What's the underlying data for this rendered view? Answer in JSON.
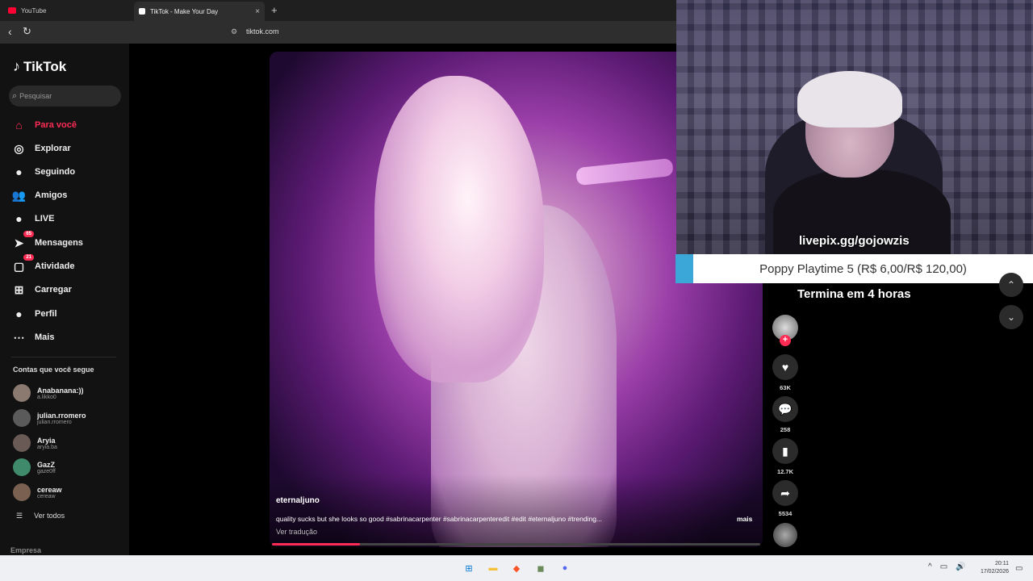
{
  "browser": {
    "tabs": [
      {
        "title": "YouTube",
        "active": false,
        "favicon_color": "#ff0033"
      },
      {
        "title": "TikTok - Make Your Day",
        "active": true,
        "favicon_color": "#ffffff"
      }
    ],
    "new_tab_label": "+",
    "close_label": "×",
    "url": "tiktok.com",
    "icons": {
      "back": "‹",
      "reload": "↻",
      "site_info": "⚙"
    }
  },
  "tiktok": {
    "logo_text": "TikTok",
    "search_placeholder": "Pesquisar",
    "nav": [
      {
        "label": "Para você",
        "icon": "home-icon",
        "glyph": "⌂",
        "active": true
      },
      {
        "label": "Explorar",
        "icon": "compass-icon",
        "glyph": "◎"
      },
      {
        "label": "Seguindo",
        "icon": "following-icon",
        "glyph": "●"
      },
      {
        "label": "Amigos",
        "icon": "friends-icon",
        "glyph": "👥"
      },
      {
        "label": "LIVE",
        "icon": "live-icon",
        "glyph": "●"
      },
      {
        "label": "Mensagens",
        "icon": "messages-icon",
        "glyph": "➤",
        "badge": "65"
      },
      {
        "label": "Atividade",
        "icon": "activity-icon",
        "glyph": "▢",
        "badge": "21"
      },
      {
        "label": "Carregar",
        "icon": "upload-icon",
        "glyph": "⊞"
      },
      {
        "label": "Perfil",
        "icon": "profile-icon",
        "glyph": "●"
      },
      {
        "label": "Mais",
        "icon": "more-icon",
        "glyph": "⋯"
      }
    ],
    "following_title": "Contas que você segue",
    "following": [
      {
        "name": "Anabanana:))",
        "handle": "a.likko0",
        "color": "#8a7a70"
      },
      {
        "name": "julian.rromero",
        "handle": "julian.rromero",
        "color": "#5a5a5a"
      },
      {
        "name": "Aryia",
        "handle": "aryia.ba",
        "color": "#6a5a55"
      },
      {
        "name": "GazZ",
        "handle": "gaze0ff",
        "color": "#3e8a6a"
      },
      {
        "name": "cereaw",
        "handle": "cereaw",
        "color": "#7a6050"
      }
    ],
    "see_all": "Ver todos",
    "empresa": "Empresa"
  },
  "video": {
    "author": "eternaljuno",
    "caption": "quality sucks but she looks so good #sabrinacarpenter #sabrinacarpenteredit #edit #eternaljuno #trending...",
    "more_label": "mais",
    "translate_label": "Ver tradução",
    "progress": 0.18,
    "actions": [
      {
        "name": "like",
        "glyph": "♥",
        "count": "63K"
      },
      {
        "name": "comment",
        "glyph": "💬",
        "count": "258"
      },
      {
        "name": "bookmark",
        "glyph": "▮",
        "count": "12.7K"
      },
      {
        "name": "share",
        "glyph": "➦",
        "count": "5534"
      }
    ],
    "follow_plus": "+"
  },
  "overlay": {
    "livepix": "livepix.gg/gojowzis",
    "banner_text": "Poppy Playtime 5 (R$ 6,00/R$ 120,00)",
    "ends_text": "Termina em 4 horas",
    "accent_color": "#3ba6d8"
  },
  "feed_nav": {
    "up": "⌃",
    "down": "⌄"
  },
  "taskbar": {
    "apps": [
      {
        "name": "windows-start",
        "glyph": "⊞",
        "color": "#0078d4"
      },
      {
        "name": "file-explorer",
        "glyph": "▬",
        "color": "#f3c13a"
      },
      {
        "name": "brave-browser",
        "glyph": "◆",
        "color": "#fb542b"
      },
      {
        "name": "game-app",
        "glyph": "◼",
        "color": "#6a8a5a"
      },
      {
        "name": "discord",
        "glyph": "●",
        "color": "#5865f2"
      }
    ],
    "tray": {
      "chevron": "^",
      "network": "▭",
      "volume": "🔊"
    },
    "time": "20:11",
    "date": "17/02/2026"
  }
}
